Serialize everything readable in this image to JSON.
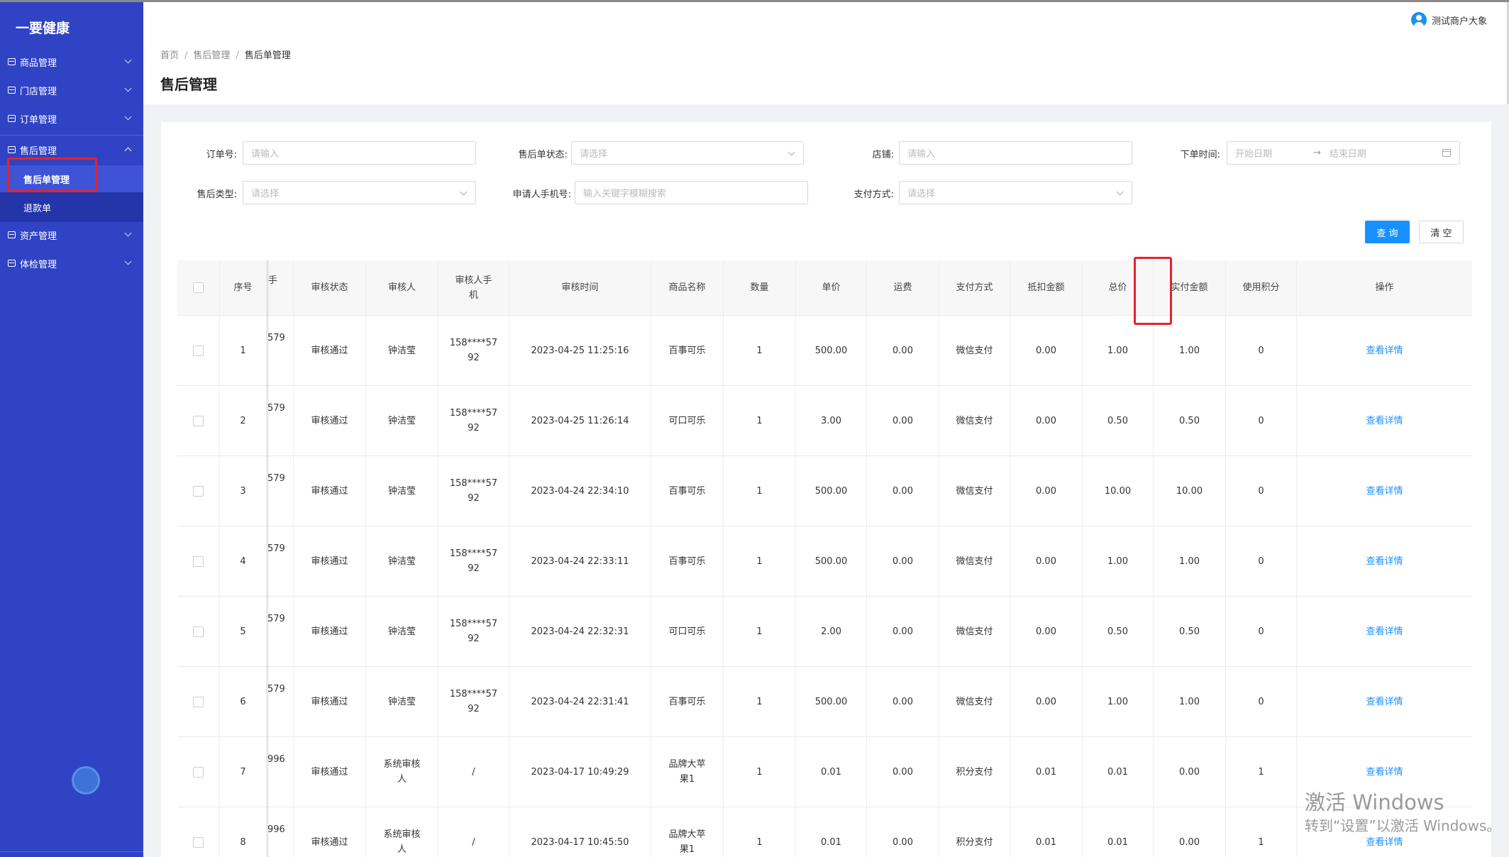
{
  "app": {
    "logo": "一要健康"
  },
  "sidebar": {
    "items": [
      {
        "label": "商品管理"
      },
      {
        "label": "门店管理"
      },
      {
        "label": "订单管理"
      },
      {
        "label": "售后管理"
      },
      {
        "label": "资产管理"
      },
      {
        "label": "体检管理"
      }
    ],
    "submenu": [
      {
        "label": "售后单管理"
      },
      {
        "label": "退款单"
      }
    ]
  },
  "header": {
    "user": "测试商户大象",
    "breadcrumb": [
      "首页",
      "售后管理",
      "售后单管理"
    ],
    "title": "售后管理"
  },
  "filters": {
    "order_no": {
      "label": "订单号:",
      "placeholder": "请输入"
    },
    "status": {
      "label": "售后单状态:",
      "placeholder": "请选择"
    },
    "shop": {
      "label": "店铺:",
      "placeholder": "请输入"
    },
    "order_time": {
      "label": "下单时间:",
      "start": "开始日期",
      "end": "结束日期"
    },
    "type": {
      "label": "售后类型:",
      "placeholder": "请选择"
    },
    "phone": {
      "label": "申请人手机号:",
      "placeholder": "输入关键字模糊搜索"
    },
    "pay": {
      "label": "支付方式:",
      "placeholder": "请选择"
    },
    "query_btn": "查 询",
    "clear_btn": "清 空"
  },
  "table": {
    "columns": {
      "partial": "手",
      "seq": "序号",
      "status": "审核状态",
      "reviewer": "审核人",
      "reviewer_phone": "审核人手机",
      "review_time": "审核时间",
      "product": "商品名称",
      "qty": "数量",
      "unit_price": "单价",
      "freight": "运费",
      "pay_method": "支付方式",
      "deduct": "抵扣金额",
      "total": "总价",
      "paid": "实付金额",
      "points": "使用积分",
      "ops": "操作"
    },
    "rows": [
      {
        "partial": "579",
        "seq": "1",
        "status": "审核通过",
        "reviewer": "钟洁莹",
        "phone": "158****5792",
        "time": "2023-04-25 11:25:16",
        "product": "百事可乐",
        "qty": "1",
        "price": "500.00",
        "freight": "0.00",
        "pay": "微信支付",
        "deduct": "0.00",
        "total": "1.00",
        "paid": "1.00",
        "points": "0",
        "op": "查看详情"
      },
      {
        "partial": "579",
        "seq": "2",
        "status": "审核通过",
        "reviewer": "钟洁莹",
        "phone": "158****5792",
        "time": "2023-04-25 11:26:14",
        "product": "可口可乐",
        "qty": "1",
        "price": "3.00",
        "freight": "0.00",
        "pay": "微信支付",
        "deduct": "0.00",
        "total": "0.50",
        "paid": "0.50",
        "points": "0",
        "op": "查看详情"
      },
      {
        "partial": "579",
        "seq": "3",
        "status": "审核通过",
        "reviewer": "钟洁莹",
        "phone": "158****5792",
        "time": "2023-04-24 22:34:10",
        "product": "百事可乐",
        "qty": "1",
        "price": "500.00",
        "freight": "0.00",
        "pay": "微信支付",
        "deduct": "0.00",
        "total": "10.00",
        "paid": "10.00",
        "points": "0",
        "op": "查看详情"
      },
      {
        "partial": "579",
        "seq": "4",
        "status": "审核通过",
        "reviewer": "钟洁莹",
        "phone": "158****5792",
        "time": "2023-04-24 22:33:11",
        "product": "百事可乐",
        "qty": "1",
        "price": "500.00",
        "freight": "0.00",
        "pay": "微信支付",
        "deduct": "0.00",
        "total": "1.00",
        "paid": "1.00",
        "points": "0",
        "op": "查看详情"
      },
      {
        "partial": "579",
        "seq": "5",
        "status": "审核通过",
        "reviewer": "钟洁莹",
        "phone": "158****5792",
        "time": "2023-04-24 22:32:31",
        "product": "可口可乐",
        "qty": "1",
        "price": "2.00",
        "freight": "0.00",
        "pay": "微信支付",
        "deduct": "0.00",
        "total": "0.50",
        "paid": "0.50",
        "points": "0",
        "op": "查看详情"
      },
      {
        "partial": "579",
        "seq": "6",
        "status": "审核通过",
        "reviewer": "钟洁莹",
        "phone": "158****5792",
        "time": "2023-04-24 22:31:41",
        "product": "百事可乐",
        "qty": "1",
        "price": "500.00",
        "freight": "0.00",
        "pay": "微信支付",
        "deduct": "0.00",
        "total": "1.00",
        "paid": "1.00",
        "points": "0",
        "op": "查看详情"
      },
      {
        "partial": "996",
        "seq": "7",
        "status": "审核通过",
        "reviewer": "系统审核人",
        "phone": "/",
        "time": "2023-04-17 10:49:29",
        "product": "品牌大苹果1",
        "qty": "1",
        "price": "0.01",
        "freight": "0.00",
        "pay": "积分支付",
        "deduct": "0.01",
        "total": "0.01",
        "paid": "0.00",
        "points": "1",
        "op": "查看详情"
      },
      {
        "partial": "996",
        "seq": "8",
        "status": "审核通过",
        "reviewer": "系统审核人",
        "phone": "/",
        "time": "2023-04-17 10:45:50",
        "product": "品牌大苹果1",
        "qty": "1",
        "price": "0.01",
        "freight": "0.00",
        "pay": "积分支付",
        "deduct": "0.01",
        "total": "0.01",
        "paid": "0.00",
        "points": "1",
        "op": "查看详情"
      }
    ]
  },
  "watermark": {
    "line1": "激活 Windows",
    "line2": "转到“设置”以激活 Windows。"
  },
  "colors": {
    "sidebar": "#2f43c4",
    "primary": "#1890ff",
    "highlight": "#e8212e"
  }
}
